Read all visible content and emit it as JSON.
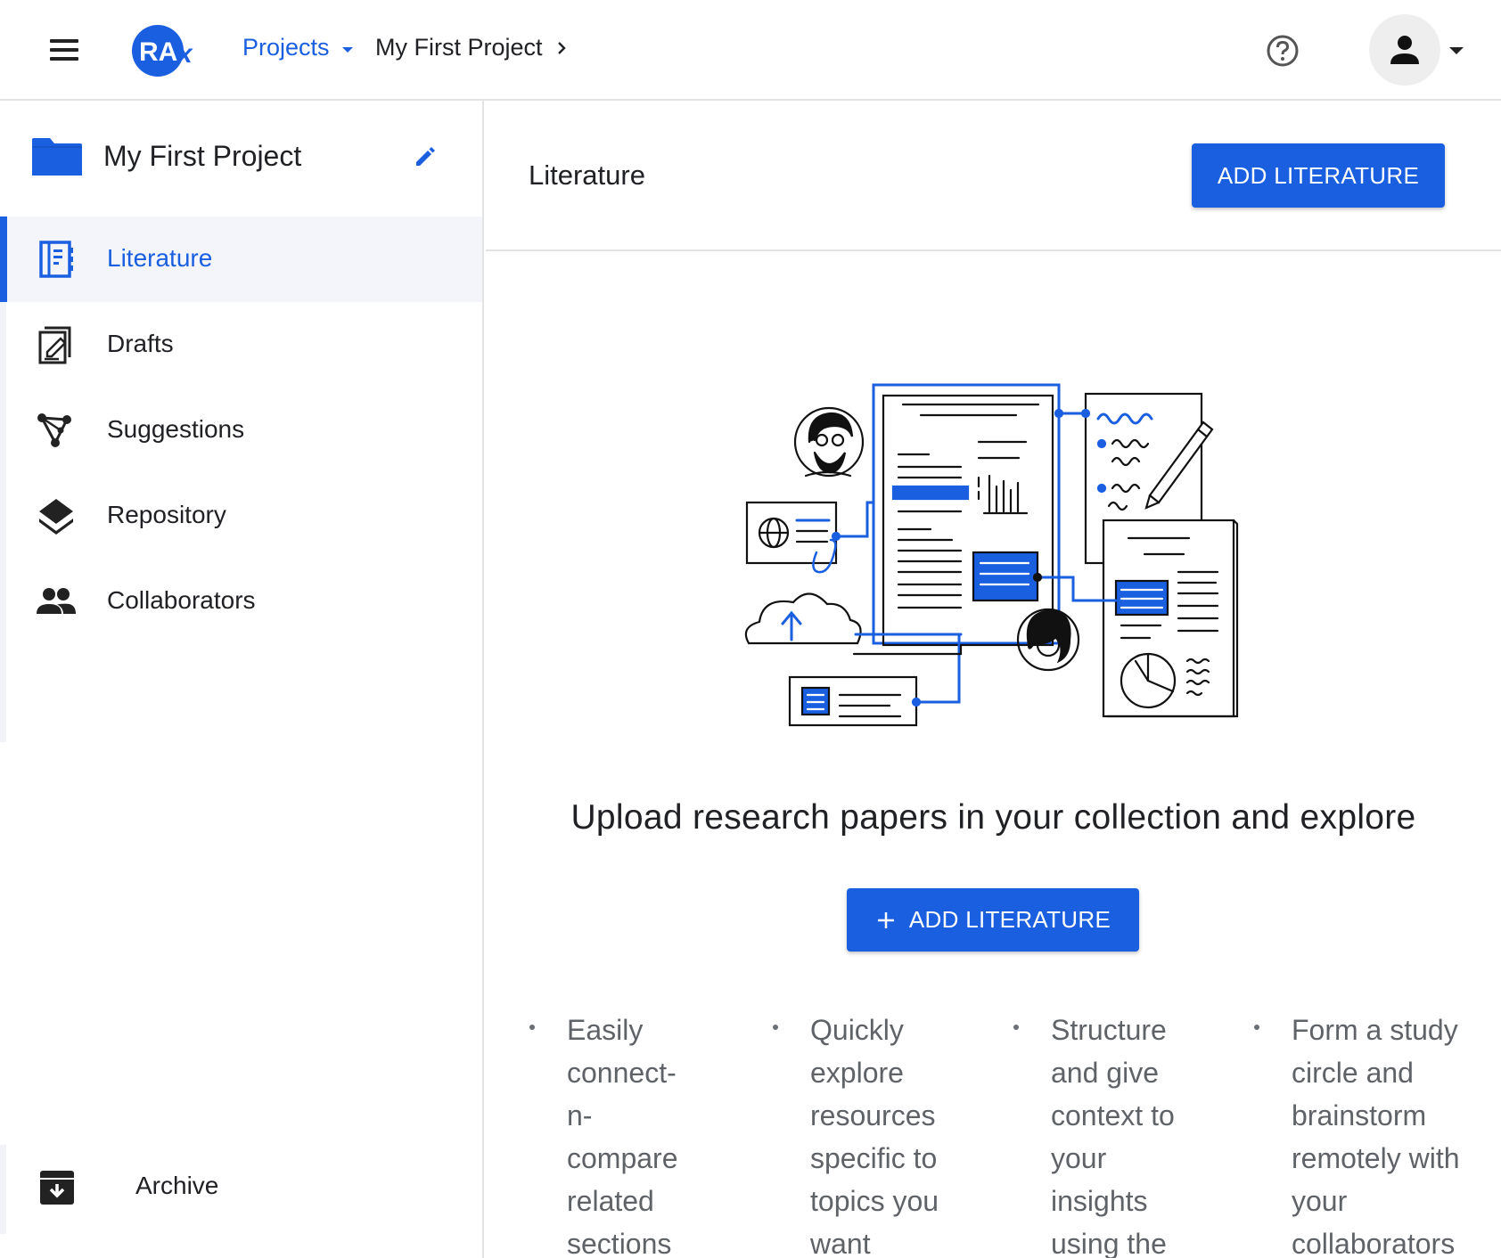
{
  "topbar": {
    "logo_text": "RAx",
    "projects_label": "Projects",
    "current_project": "My First Project"
  },
  "sidebar": {
    "project_name": "My First Project",
    "items": [
      {
        "label": "Literature",
        "icon": "notebook-icon",
        "active": true
      },
      {
        "label": "Drafts",
        "icon": "edit-document-icon",
        "active": false
      },
      {
        "label": "Suggestions",
        "icon": "network-icon",
        "active": false
      },
      {
        "label": "Repository",
        "icon": "layers-icon",
        "active": false
      },
      {
        "label": "Collaborators",
        "icon": "people-icon",
        "active": false
      }
    ],
    "archive_label": "Archive"
  },
  "main": {
    "title": "Literature",
    "add_button_label": "ADD LITERATURE",
    "headline": "Upload research papers in your collection and explore",
    "center_button_label": "ADD LITERATURE",
    "features": [
      "Easily connect-n-compare related sections",
      "Quickly explore resources specific to topics you want",
      "Structure and give context to your insights using the",
      "Form a study circle and brainstorm remotely with your collaborators"
    ]
  },
  "colors": {
    "accent": "#1a5fe0",
    "active_bg": "#f3f5fa",
    "text": "#202124",
    "muted_text": "#5f6368"
  }
}
